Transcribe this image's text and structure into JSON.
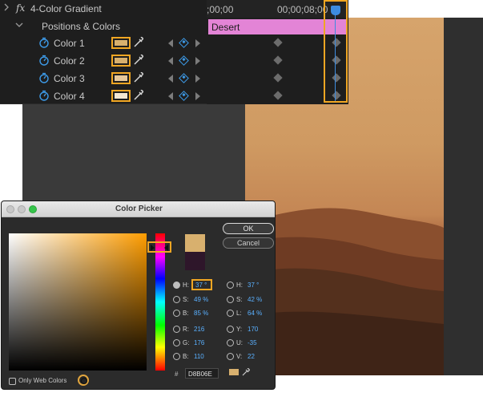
{
  "effect": {
    "name": "4-Color Gradient",
    "fx_glyph": "fx",
    "group_label": "Positions & Colors",
    "colors": [
      {
        "label": "Color 1",
        "swatch": "#d8b06e"
      },
      {
        "label": "Color 2",
        "swatch": "#d8b06e"
      },
      {
        "label": "Color 3",
        "swatch": "#e6c89b"
      },
      {
        "label": "Color 4",
        "swatch": "#f3e7d3"
      }
    ]
  },
  "timeline": {
    "timecode_left": ";00;00",
    "timecode_right": "00;00;08;00",
    "clip_name": "Desert",
    "playhead_color": "#3d8ce0"
  },
  "picker": {
    "title": "Color Picker",
    "ok_label": "OK",
    "cancel_label": "Cancel",
    "new_color": "#d8b06e",
    "old_color": "#2e162a",
    "hsb": [
      {
        "label": "H:",
        "value": "37 °",
        "selected": true
      },
      {
        "label": "S:",
        "value": "49 %",
        "selected": false
      },
      {
        "label": "B:",
        "value": "85 %",
        "selected": false
      }
    ],
    "rgb": [
      {
        "label": "R:",
        "value": "216"
      },
      {
        "label": "G:",
        "value": "176"
      },
      {
        "label": "B:",
        "value": "110"
      }
    ],
    "hsl": [
      {
        "label": "H:",
        "value": "37 °"
      },
      {
        "label": "S:",
        "value": "42 %"
      },
      {
        "label": "L:",
        "value": "64 %"
      }
    ],
    "yuv": [
      {
        "label": "Y:",
        "value": "170"
      },
      {
        "label": "U:",
        "value": "-35"
      },
      {
        "label": "V:",
        "value": "22"
      }
    ],
    "hex_label": "#",
    "hex_value": "D8B06E",
    "only_web_colors_label": "Only Web Colors"
  },
  "accent_color": "#f0a623"
}
